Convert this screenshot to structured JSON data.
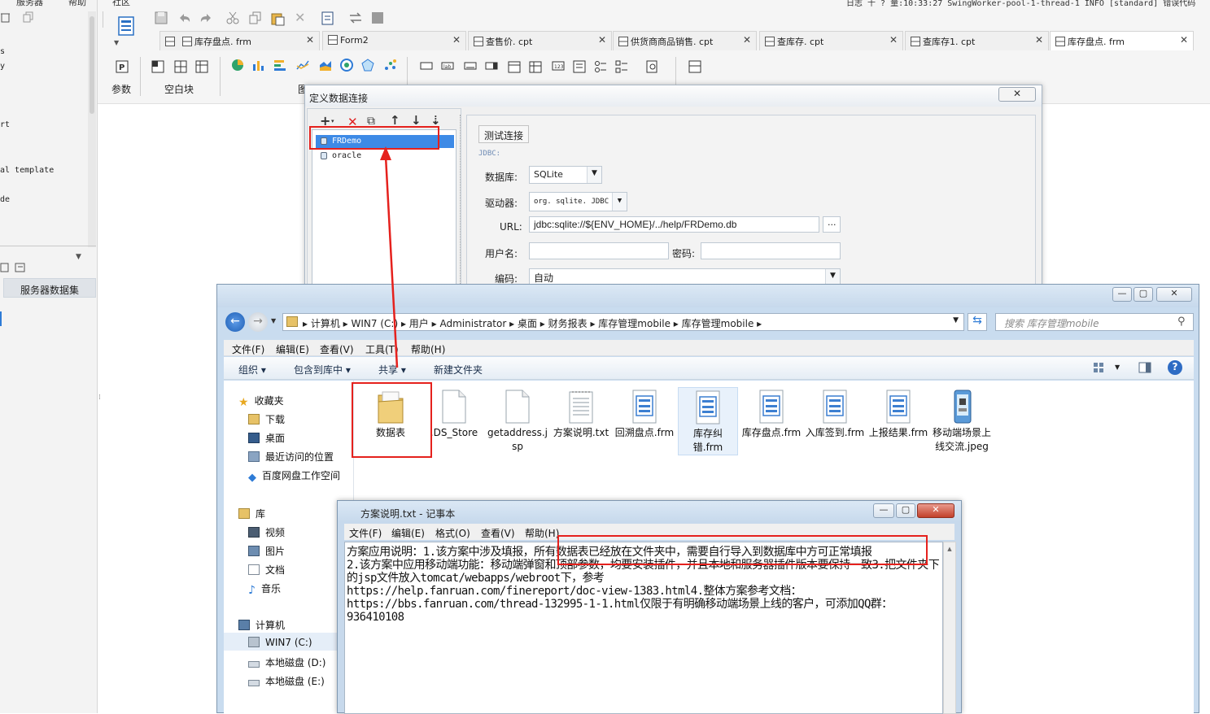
{
  "top_status": "日志 十 ? 量:10:33:27 SwingWorker-pool-1-thread-1 INFO [standard] 错误代码",
  "top_menu": {
    "item1": "服务器",
    "item2": "帮助",
    "item3": "社区"
  },
  "left_panel": {
    "tree_items": [
      "s",
      "y",
      "rt",
      "al template",
      "de"
    ],
    "server_dataset_tab": "服务器数据集"
  },
  "tabs": [
    {
      "label": "库存盘点. frm"
    },
    {
      "label": "Form2"
    },
    {
      "label": "查售价. cpt"
    },
    {
      "label": "供货商商品销售. cpt"
    },
    {
      "label": "查库存. cpt"
    },
    {
      "label": "查库存1. cpt"
    },
    {
      "label": "库存盘点. frm"
    }
  ],
  "ribbon": {
    "params_label": "参数",
    "blank_block_label": "空白块",
    "chart_label_fragment": "图"
  },
  "dialog": {
    "title": "定义数据连接",
    "close_symbol": "✕",
    "toolbar": {
      "add": "+",
      "delete": "✕",
      "copy": "⧉",
      "up": "↑",
      "down": "↓",
      "sort": "⇣"
    },
    "connections": [
      "FRDemo",
      "oracle"
    ],
    "test_button": "测试连接",
    "jdbc_label": "JDBC:",
    "database_label": "数据库:",
    "database_value": "SQLite",
    "driver_label": "驱动器:",
    "driver_value": "org. sqlite. JDBC",
    "url_label": "URL:",
    "url_value": "jdbc:sqlite://${ENV_HOME}/../help/FRDemo.db",
    "url_more": "...",
    "username_label": "用户名:",
    "password_label": "密码:",
    "encoding_label": "编码:",
    "encoding_value": "自动"
  },
  "explorer": {
    "address_parts": [
      "计算机",
      "WIN7 (C:)",
      "用户",
      "Administrator",
      "桌面",
      "财务报表",
      "库存管理mobile",
      "库存管理mobile"
    ],
    "search_placeholder": "搜索 库存管理mobile",
    "menu": [
      "文件(F)",
      "编辑(E)",
      "查看(V)",
      "工具(T)",
      "帮助(H)"
    ],
    "commands": [
      "组织 ▾",
      "包含到库中 ▾",
      "共享 ▾",
      "新建文件夹"
    ],
    "nav": {
      "favorites": "收藏夹",
      "downloads": "下载",
      "desktop": "桌面",
      "recent": "最近访问的位置",
      "baidu": "百度网盘工作空间",
      "libraries": "库",
      "videos": "视频",
      "pictures": "图片",
      "documents": "文档",
      "music": "音乐",
      "computer": "计算机",
      "drive_c": "WIN7 (C:)",
      "drive_d": "本地磁盘 (D:)",
      "drive_e": "本地磁盘 (E:)"
    },
    "files": [
      {
        "name": "数据表",
        "type": "folder"
      },
      {
        "name": ".DS_Store",
        "type": "file"
      },
      {
        "name": "getaddress.jsp",
        "type": "file"
      },
      {
        "name": "方案说明.txt",
        "type": "text"
      },
      {
        "name": "回溯盘点.frm",
        "type": "frm"
      },
      {
        "name": "库存纠错.frm",
        "type": "frm"
      },
      {
        "name": "库存盘点.frm",
        "type": "frm"
      },
      {
        "name": "入库签到.frm",
        "type": "frm"
      },
      {
        "name": "上报结果.frm",
        "type": "frm"
      },
      {
        "name": "移动端场景上线交流.jpeg",
        "type": "image"
      }
    ]
  },
  "notepad": {
    "title": "方案说明.txt - 记事本",
    "menu": [
      "文件(F)",
      "编辑(E)",
      "格式(O)",
      "查看(V)",
      "帮助(H)"
    ],
    "text": "方案应用说明：1.该方案中涉及填报，所有数据表已经放在文件夹中，需要自行导入到数据库中方可正常填报\n2.该方案中应用移动端功能：移动端弹窗和顶部参数，均要安装插件，并且本地和服务器插件版本要保持一致3.把文件夹下的jsp文件放入tomcat/webapps/webroot下，参考\nhttps://help.fanruan.com/finereport/doc-view-1383.html4.整体方案参考文档：\nhttps://bbs.fanruan.com/thread-132995-1-1.html仅限于有明确移动端场景上线的客户，可添加QQ群：936410108"
  },
  "colors": {
    "highlight_red": "#e5211d",
    "selection_blue": "#3d8ae6"
  }
}
